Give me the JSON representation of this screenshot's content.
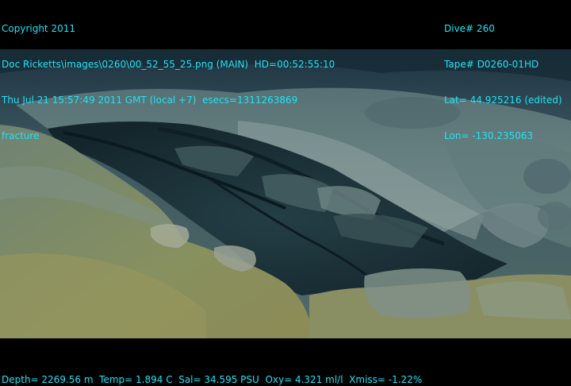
{
  "header": {
    "copyright": "Copyright 2011",
    "image_path": "Doc Ricketts\\images\\0260\\00_52_55_25.png (MAIN)  HD=00:52:55:10",
    "datetime": "Thu Jul 21 15:57:49 2011 GMT (local +7)  esecs=1311263869",
    "annotation": "fracture",
    "dive": "Dive# 260",
    "tape": "Tape# D0260-01HD",
    "lat": "Lat= 44.925216 (edited)",
    "lon": "Lon= -130.235063"
  },
  "footer": {
    "telemetry": "Depth= 2269.56 m  Temp= 1.894 C  Sal= 34.595 PSU  Oxy= 4.321 ml/l  Xmiss= -1.22%"
  },
  "colors": {
    "overlay_text": "#1fe3f5",
    "background": "#000000"
  }
}
